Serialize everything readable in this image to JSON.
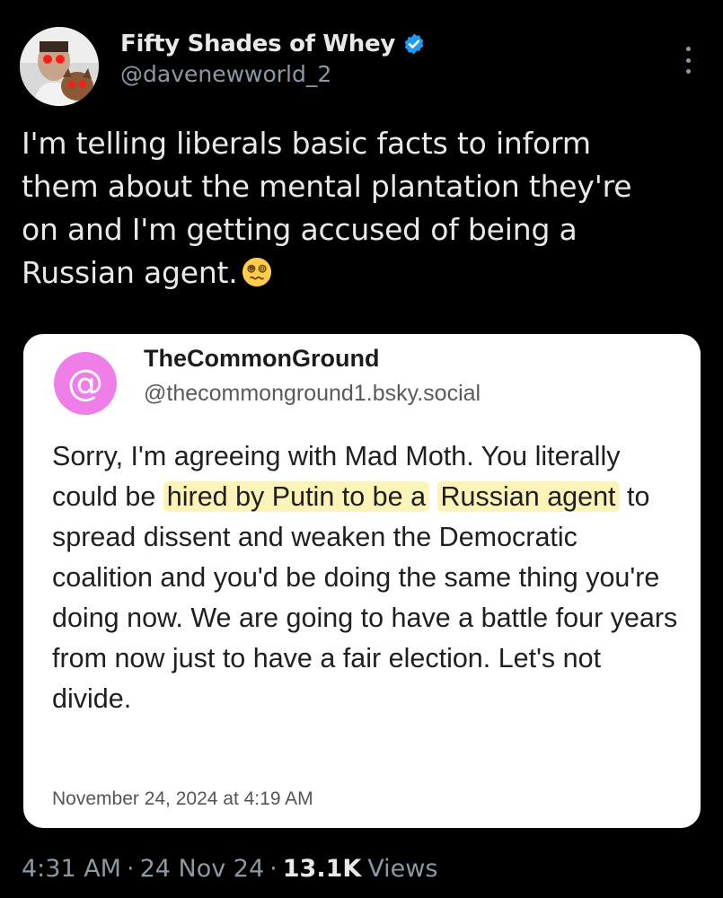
{
  "tweet": {
    "display_name": "Fifty Shades of Whey",
    "handle": "@davenewworld_2",
    "text_line1": "I'm telling liberals basic facts to inform",
    "text_line2": "them about the mental plantation they're",
    "text_line3": "on and I'm getting accused of being a",
    "text_line4": "Russian agent.",
    "emoji": "dizzy-face-emoji",
    "verified_color": "#1d9bf0"
  },
  "quote": {
    "avatar_symbol": "@",
    "avatar_color": "#f07ee8",
    "name": "TheCommonGround",
    "handle": "@thecommonground1.bsky.social",
    "text_part1": "Sorry, I'm agreeing with Mad Moth. You literally could be ",
    "highlight1": "hired by Putin to be a",
    "highlight2": "Russian agent",
    "text_part2": " to spread dissent and weaken the Democratic coalition and you'd be doing the same thing you're doing now. We are going to have a battle four years from now just to have a fair election. Let's not divide.",
    "highlight_color": "#fbf3b8",
    "date": "November 24, 2024 at 4:19 AM"
  },
  "meta": {
    "time": "4:31 AM",
    "separator": "·",
    "date": "24 Nov 24",
    "views_count": "13.1K",
    "views_label": "Views"
  }
}
